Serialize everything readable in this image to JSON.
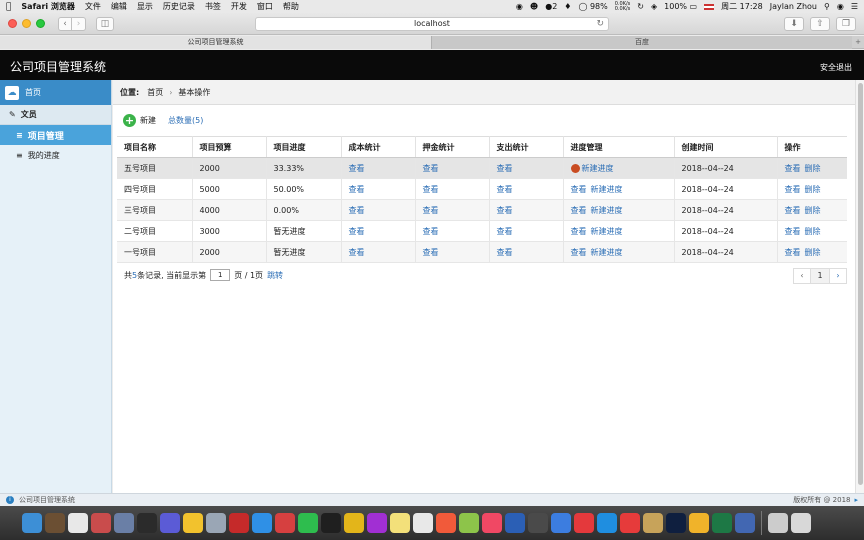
{
  "menubar": {
    "app": "Safari 浏览器",
    "items": [
      "文件",
      "编辑",
      "显示",
      "历史记录",
      "书签",
      "开发",
      "窗口",
      "帮助"
    ],
    "wechat_count": "2",
    "net_up": "0.0K/s",
    "net_down": "0.0K/s",
    "battery": "98%",
    "volume": "100%",
    "clock": "周二 17:28",
    "user": "Jaylan Zhou"
  },
  "browser": {
    "url": "localhost",
    "tabs": [
      {
        "label": "公司项目管理系统"
      },
      {
        "label": "百度"
      }
    ]
  },
  "header": {
    "title": "公司项目管理系统",
    "logout": "安全退出"
  },
  "sidebar": {
    "home": "首页",
    "group": "文员",
    "items": [
      {
        "label": "项目管理"
      },
      {
        "label": "我的进度"
      }
    ]
  },
  "breadcrumb": {
    "label": "位置:",
    "home": "首页",
    "current": "基本操作"
  },
  "actions": {
    "new_label": "新建",
    "total_label": "总数量(5)"
  },
  "table": {
    "columns": [
      "项目名称",
      "项目预算",
      "项目进度",
      "成本统计",
      "押金统计",
      "支出统计",
      "进度管理",
      "创建时间",
      "操作"
    ],
    "rows": [
      {
        "name": "五号项目",
        "budget": "2000",
        "progress": "33.33%",
        "cost": "查看",
        "deposit": "查看",
        "expense": "查看",
        "p_view": "查看",
        "p_new": "新建进度",
        "date": "2018--04--24",
        "op_view": "查看",
        "op_delete": "删除"
      },
      {
        "name": "四号项目",
        "budget": "5000",
        "progress": "50.00%",
        "cost": "查看",
        "deposit": "查看",
        "expense": "查看",
        "p_view": "查看",
        "p_new": "新建进度",
        "date": "2018--04--24",
        "op_view": "查看",
        "op_delete": "删除"
      },
      {
        "name": "三号项目",
        "budget": "4000",
        "progress": "0.00%",
        "cost": "查看",
        "deposit": "查看",
        "expense": "查看",
        "p_view": "查看",
        "p_new": "新建进度",
        "date": "2018--04--24",
        "op_view": "查看",
        "op_delete": "删除"
      },
      {
        "name": "二号项目",
        "budget": "3000",
        "progress": "暂无进度",
        "cost": "查看",
        "deposit": "查看",
        "expense": "查看",
        "p_view": "查看",
        "p_new": "新建进度",
        "date": "2018--04--24",
        "op_view": "查看",
        "op_delete": "删除"
      },
      {
        "name": "一号项目",
        "budget": "2000",
        "progress": "暂无进度",
        "cost": "查看",
        "deposit": "查看",
        "expense": "查看",
        "p_view": "查看",
        "p_new": "新建进度",
        "date": "2018--04--24",
        "op_view": "查看",
        "op_delete": "删除"
      }
    ]
  },
  "pagination": {
    "prefix": "共",
    "total": "5",
    "suffix": "条记录,  当前显示第",
    "page_value": "1",
    "pages": "页 / 1页",
    "jump": "跳转",
    "prev": "‹",
    "current": "1",
    "next": "›"
  },
  "footer": {
    "left": "公司项目管理系统",
    "right": "版权所有 @ 2018"
  },
  "dock_apps": [
    "#3d8fd6",
    "#6b4f33",
    "#e8e8e8",
    "#c94c4c",
    "#6a7fa6",
    "#2b2b2b",
    "#5b5bd6",
    "#f2c22d",
    "#9aa6b5",
    "#c52a2a",
    "#2f90e6",
    "#d64040",
    "#2ebd4e",
    "#1f1f1f",
    "#e3b51a",
    "#a12fd3",
    "#f3e07a",
    "#e8e8e8",
    "#f15a3a",
    "#8dc44a",
    "#f04864",
    "#2b5fb5",
    "#4a4a4a",
    "#3c7de0",
    "#e4393c",
    "#1f8ee0",
    "#e63b3b",
    "#c7a35a",
    "#0f1f3f",
    "#f0b32a",
    "#1d7845",
    "#4267b2",
    "#cccccc",
    "#d8d8d8"
  ]
}
